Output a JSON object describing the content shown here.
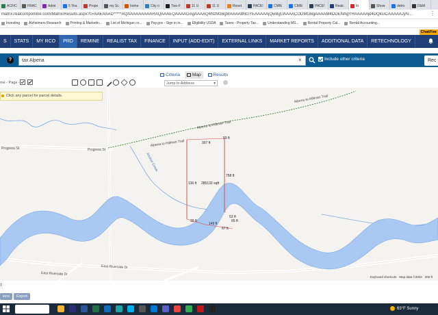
{
  "browser": {
    "tabs": [
      {
        "label": "ACFiC",
        "color": "#2a7d4f"
      },
      {
        "label": "FRAC",
        "color": "#5a5a5a"
      },
      {
        "label": "Admi",
        "color": "#7b2ab0"
      },
      {
        "label": "5 Yea",
        "color": "#1a73e8"
      },
      {
        "label": "Prope",
        "color": "#c0392b"
      },
      {
        "label": "my Sc",
        "color": "#555555"
      },
      {
        "label": "home",
        "color": "#d35400"
      },
      {
        "label": "City o",
        "color": "#2980b9"
      },
      {
        "label": "Two-F",
        "color": "#1e1e1e"
      },
      {
        "label": "11 U",
        "color": "#c0392b"
      },
      {
        "label": "11 U",
        "color": "#c0392b"
      },
      {
        "label": "Reset",
        "color": "#e67e22"
      },
      {
        "label": "PACE!",
        "color": "#2c3e50"
      },
      {
        "label": "CM/E",
        "color": "#1a73e8"
      },
      {
        "label": "CM/E",
        "color": "#1a73e8"
      },
      {
        "label": "PACE!",
        "color": "#2c3e50"
      },
      {
        "label": "Realc",
        "color": "#1f3f76"
      },
      {
        "label": "fo",
        "color": "#d62828",
        "active": true
      },
      {
        "label": "Show",
        "color": "#555555"
      },
      {
        "label": "detro",
        "color": "#1a73e8"
      },
      {
        "label": "D&M",
        "color": "#333333"
      }
    ],
    "url": "matrix.realcomponline.com/Matrix/Results.aspx?c=AAEAAAD*****AQAAAAAAAAARAQAAAEQAAAAGAgAAAAQ4NzMzBgMAAAA8NGYEAAAAAjQwBgUAAAACODMGBgAAAAM4ODENAgYHAAAAAjo4DQkGCAAAAAJyN...",
    "bookmarks": [
      "Investing",
      "Alzheimers Research",
      "Printing & Marketin...",
      "List of Michigan co...",
      "Pay.gov - Sign in to...",
      "Eligibility USDA",
      "Taxes - Property Tax...",
      "Understanding MS...",
      "Rental Property Cal...",
      "Rental Accounting..."
    ],
    "chat_badge": "Chat/Fee"
  },
  "nav": {
    "items": [
      {
        "label": "S"
      },
      {
        "label": "STATS"
      },
      {
        "label": "MY RCO"
      },
      {
        "label": "PRD",
        "active": true
      },
      {
        "label": "REMINE"
      },
      {
        "label": "REALIST TAX"
      },
      {
        "label": "FINANCE"
      },
      {
        "label": "INPUT (ADD-EDIT)"
      },
      {
        "label": "EXTERNAL LINKS"
      },
      {
        "label": "MARKET REPORTS"
      },
      {
        "label": "ADDITIONAL DATA"
      },
      {
        "label": "RETECHNOLOGY"
      }
    ]
  },
  "search": {
    "help": "?",
    "value": "tax Alpena",
    "clear": "×",
    "other_criteria": "Include other criteria",
    "rec_label": "Rec"
  },
  "view_tabs": [
    {
      "label": "Criteria"
    },
    {
      "label": "Map",
      "active": true
    },
    {
      "label": "Results"
    }
  ],
  "toolbar": {
    "breadcrumb": "me - Page -",
    "jump_label": "Jump to Address",
    "jump_arrow": "▾"
  },
  "map": {
    "hint": "Click any parcel for parcel details.",
    "roads": {
      "trail_upper": "Alpena to Hillman Trail",
      "trail_mid": "Alpena to Hillman Trail",
      "trail_lower": "Alpena to Hillman Trail",
      "progress_left": "Progress St",
      "progress_right": "Progress St",
      "creek": "Anchor Creek",
      "riverside_e": "East Riverside Dr",
      "riverside": "East Riverside Dr"
    },
    "measurements": {
      "top": "307 ft",
      "top_right": "59 ft",
      "left": "130 ft",
      "area": "285132 sqft",
      "right": "758 ft",
      "bottom_left": "32 ft",
      "bottom_mid": "149 ft",
      "bottom_a": "53 ft",
      "bottom_b": "65 ft",
      "bottom_c": "67 ft"
    },
    "footer": {
      "shortcuts": "Keyboard shortcuts",
      "data": "Map data ©2023",
      "scale": "200 ft"
    },
    "colors": {
      "water": "#aac9f2",
      "water_edge": "#7aa7e0",
      "parcel": "#e53935",
      "trail": "#2e7d32"
    }
  },
  "results": {
    "count": "0",
    "buttons": [
      "ions",
      "Export"
    ]
  },
  "taskbar": {
    "weather": "63°F  Sunny",
    "apps": [
      {
        "name": "file-explorer-icon",
        "color": "#f2b233"
      },
      {
        "name": "ps-app-icon",
        "color": "#2b2f77"
      },
      {
        "name": "word-icon",
        "color": "#2b579a"
      },
      {
        "name": "excel-icon",
        "color": "#217346"
      },
      {
        "name": "outlook-icon",
        "color": "#0f6cbd"
      },
      {
        "name": "edge-icon",
        "color": "#1fa3a7"
      },
      {
        "name": "skype-icon",
        "color": "#00aff0"
      },
      {
        "name": "store-icon",
        "color": "#555555"
      },
      {
        "name": "mail-icon",
        "color": "#0078d4"
      },
      {
        "name": "teams-icon",
        "color": "#5b5fc7"
      },
      {
        "name": "chrome-icon",
        "color": "#e8453c"
      },
      {
        "name": "chrome-2-icon",
        "color": "#34a853"
      },
      {
        "name": "mcafee-icon",
        "color": "#c01818"
      },
      {
        "name": "app-dark-icon",
        "color": "#222222"
      }
    ]
  }
}
